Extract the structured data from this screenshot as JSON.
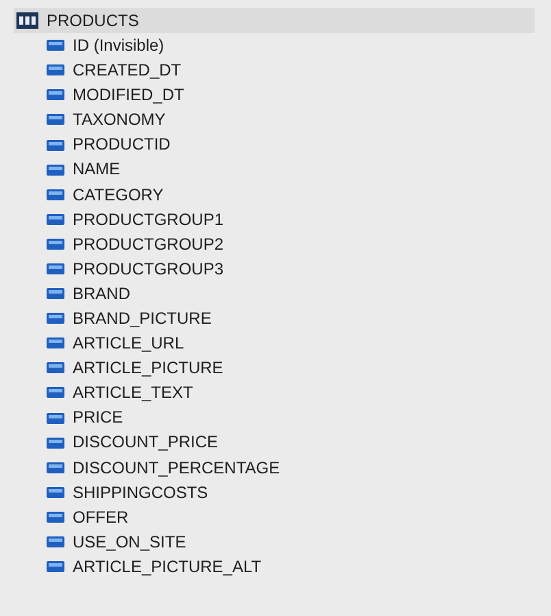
{
  "tree": [
    {
      "label": "PRODUCTS",
      "selected": true,
      "children": [
        {
          "label": "ID (Invisible)",
          "selected": false
        },
        {
          "label": "CREATED_DT",
          "selected": false
        },
        {
          "label": "MODIFIED_DT",
          "selected": false
        },
        {
          "label": "TAXONOMY",
          "selected": false
        },
        {
          "label": "PRODUCTID",
          "selected": false
        },
        {
          "label": "NAME",
          "selected": false
        },
        {
          "label": "CATEGORY",
          "selected": false
        },
        {
          "label": "PRODUCTGROUP1",
          "selected": false
        },
        {
          "label": "PRODUCTGROUP2",
          "selected": false
        },
        {
          "label": "PRODUCTGROUP3",
          "selected": false
        },
        {
          "label": "BRAND",
          "selected": false
        },
        {
          "label": "BRAND_PICTURE",
          "selected": false
        },
        {
          "label": "ARTICLE_URL",
          "selected": false
        },
        {
          "label": "ARTICLE_PICTURE",
          "selected": false
        },
        {
          "label": "ARTICLE_TEXT",
          "selected": false
        },
        {
          "label": "PRICE",
          "selected": false
        },
        {
          "label": "DISCOUNT_PRICE",
          "selected": false
        },
        {
          "label": "DISCOUNT_PERCENTAGE",
          "selected": false
        },
        {
          "label": "SHIPPINGCOSTS",
          "selected": false
        },
        {
          "label": "OFFER",
          "selected": false
        },
        {
          "label": "USE_ON_SITE",
          "selected": false
        },
        {
          "label": "ARTICLE_PICTURE_ALT",
          "selected": false
        }
      ]
    }
  ]
}
